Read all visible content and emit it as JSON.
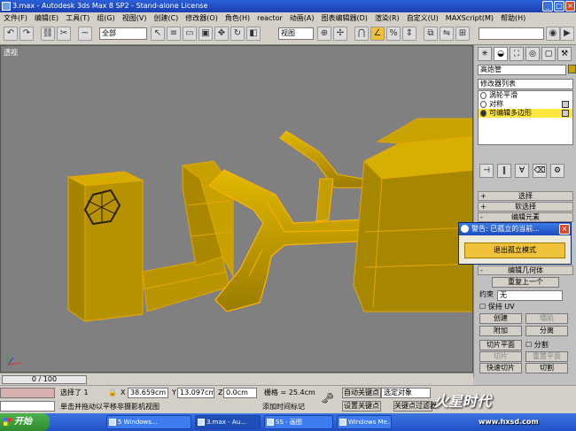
{
  "window": {
    "title": "3.max - Autodesk 3ds Max 8 SP2 - Stand-alone License"
  },
  "menu": [
    "文件(F)",
    "编辑(E)",
    "工具(T)",
    "组(G)",
    "视图(V)",
    "创建(C)",
    "修改器(O)",
    "角色(H)",
    "reactor",
    "动画(A)",
    "图表编辑器(D)",
    "渲染(R)",
    "自定义(U)",
    "MAXScript(M)",
    "帮助(H)"
  ],
  "toolbar": {
    "selection_filter": "全部",
    "coord_system": "视图"
  },
  "viewport": {
    "label": "透视"
  },
  "command_panel": {
    "object_name": "高炮管",
    "object_color": "#c8a200",
    "modifier_list": "修改器列表",
    "stack": [
      {
        "label": "涡轮平滑"
      },
      {
        "label": "对称"
      },
      {
        "label": "可编辑多边形"
      }
    ],
    "rollouts": {
      "selection": "选择",
      "soft_selection": "软选择",
      "edit_elements": "编辑元素",
      "edit_geometry": "编辑几何体"
    },
    "buttons": {
      "repeat_last": "重复上一个",
      "constraint_label": "约束",
      "constraint_value": "无",
      "preserve_uv": "保持 UV",
      "create": "创建",
      "collapse": "塌陷",
      "attach": "附加",
      "detach": "分离",
      "slice_plane": "切片平面",
      "split": "分割",
      "slice": "切片",
      "reset_plane": "重置平面",
      "quickslice": "快速切片",
      "cut": "切割"
    }
  },
  "warning_dialog": {
    "title": "警告: 已孤立的当前...",
    "button": "退出孤立模式"
  },
  "timeline": {
    "frame": "0 / 100"
  },
  "status": {
    "selected": "选择了 1",
    "x": "38.659cm",
    "y": "13.097cm",
    "z": "0.0cm",
    "grid": "栅格 = 25.4cm",
    "hint": "单击并拖动以平移非摄影机视图",
    "add_time_tag": "添加时间标记",
    "auto_key": "自动关键点",
    "set_key": "设置关键点",
    "selected_object": "选定对象",
    "key_filters": "关键点过滤器"
  },
  "taskbar": {
    "start": "开始",
    "tasks": [
      "5 Windows...",
      "3.max - Au...",
      "SS - 画图",
      "Windows Me..."
    ]
  },
  "watermark": {
    "brand": "火星时代",
    "site": "www.hxsd.com"
  }
}
